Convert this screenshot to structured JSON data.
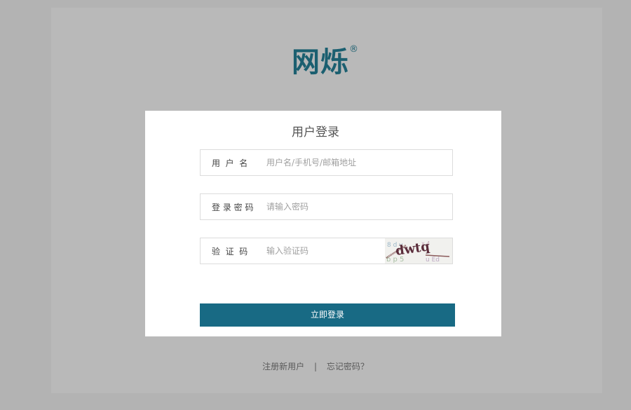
{
  "brand": {
    "name": "网烁",
    "registered_mark": "®",
    "color": "#1b5f70"
  },
  "login_form": {
    "title": "用户登录",
    "username_label": "用  户  名",
    "username_placeholder": "用户名/手机号/邮箱地址",
    "password_label": "登 录 密 码",
    "password_placeholder": "请输入密码",
    "captcha_label": "验  证  码",
    "captcha_placeholder": "输入验证码",
    "captcha_image_text": "dwtq",
    "submit_label": "立即登录",
    "submit_color": "#186a84"
  },
  "footer": {
    "register_link": "注册新用户",
    "separator": "|",
    "forgot_link": "忘记密码？"
  }
}
